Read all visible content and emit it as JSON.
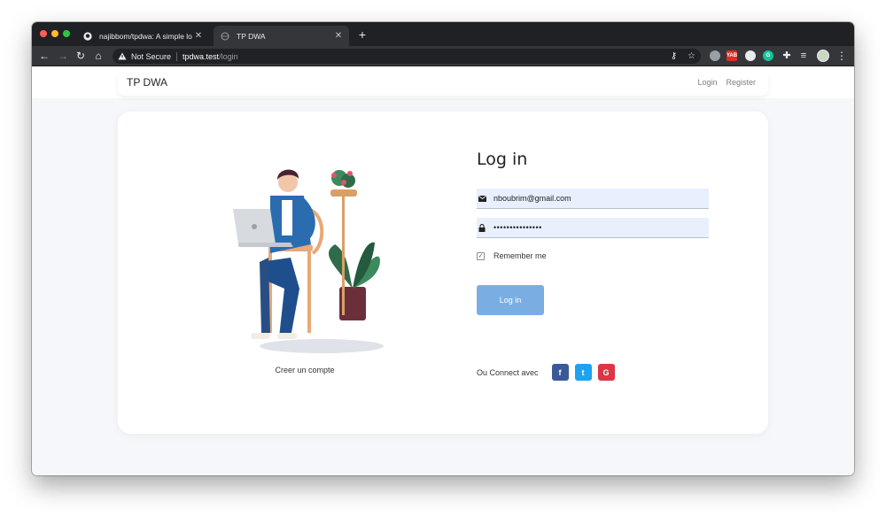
{
  "browser": {
    "tabs": [
      {
        "title": "najibbom/tpdwa: A simple login",
        "close": "✕"
      },
      {
        "title": "TP DWA",
        "close": "✕"
      }
    ],
    "new_tab": "+",
    "security": "Not Secure",
    "url_host": "tpdwa.test",
    "url_path": "/login",
    "colors": {
      "tabstrip": "#202124",
      "toolbar": "#35363a"
    }
  },
  "navbar": {
    "brand": "TP DWA",
    "links": [
      "Login",
      "Register"
    ]
  },
  "left": {
    "create_account": "Creer un compte"
  },
  "form": {
    "title": "Log in",
    "email": "nboubrim@gmail.com",
    "password": "•••••••••••••••",
    "remember": "Remember me",
    "submit": "Log in",
    "social_label": "Ou Connect avec",
    "social": [
      {
        "icon": "facebook-icon",
        "glyph": "f",
        "color": "#3b5998"
      },
      {
        "icon": "twitter-icon",
        "glyph": "t",
        "color": "#1da1f2"
      },
      {
        "icon": "google-icon",
        "glyph": "G",
        "color": "#dc3545"
      }
    ],
    "colors": {
      "button": "#7aaee3",
      "field": "#e8f0fe"
    }
  }
}
